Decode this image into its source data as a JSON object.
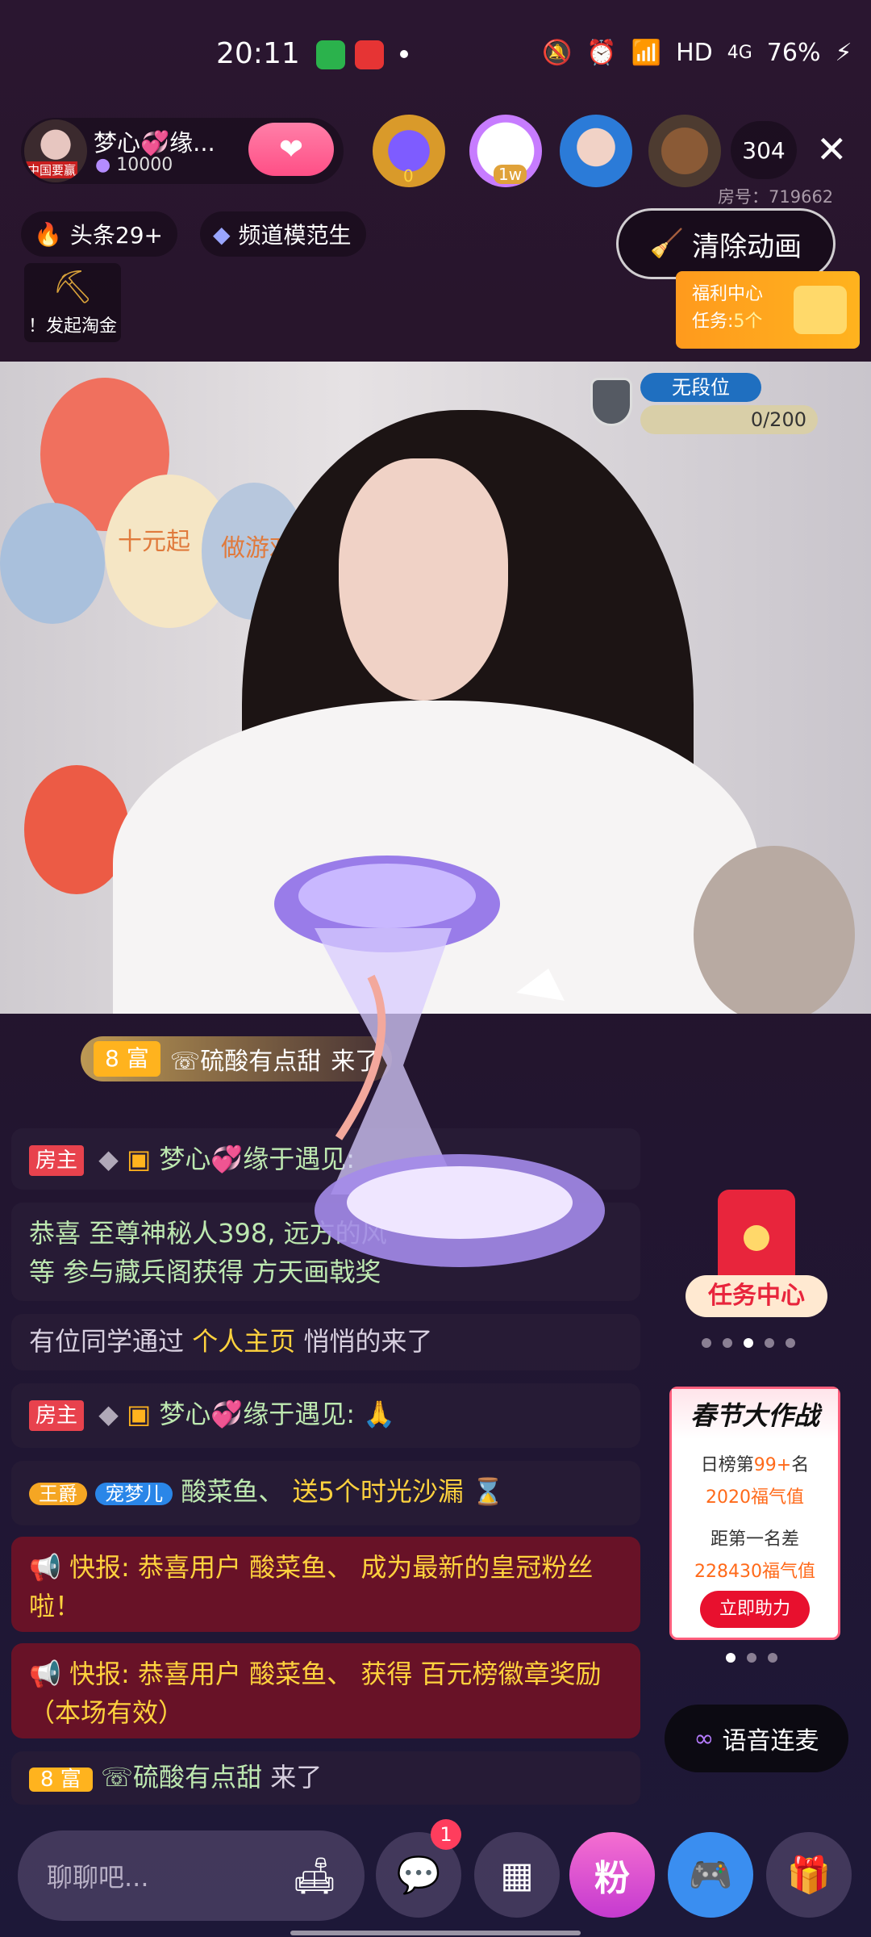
{
  "status_bar": {
    "time": "20:11",
    "network": "HD",
    "signal": "4G",
    "battery": "76%"
  },
  "anchor": {
    "name": "梦心💞缘...",
    "fans": "10000",
    "avatar_caption": "中国要赢"
  },
  "top_viewers": {
    "badge_count": "0",
    "badge_label": "1w",
    "online_count": "304"
  },
  "room": {
    "room_no": "房号：719662"
  },
  "tags": {
    "headline": "头条29+",
    "channel": "频道模范生"
  },
  "clear_animation": "清除动画",
  "treasure": "！发起淘金",
  "welfare": {
    "title": "福利中心",
    "task_prefix": "任务:",
    "task_count": "5个"
  },
  "rank": {
    "tier": "无段位",
    "progress": "0/200"
  },
  "balloon_text": {
    "left": "十元起",
    "right": "做游戏"
  },
  "chat": {
    "enter_top": {
      "level": "8 富",
      "user": "☏硫酸有点甜",
      "action": "来了"
    },
    "messages": [
      {
        "host": "房主",
        "user": "梦心💞缘于遇见:",
        "body": ""
      },
      {
        "line1": "恭喜 至尊神秘人398, 远方的风",
        "line2": "等 参与藏兵阁获得 方天画戟奖"
      },
      {
        "prefix": "有位同学通过",
        "link": "个人主页",
        "suffix": "悄悄的来了"
      },
      {
        "host": "房主",
        "user": "梦心💞缘于遇见:",
        "emoji": "🙏"
      },
      {
        "badge1": "王爵",
        "badge2": "宠梦儿",
        "user": "酸菜鱼、",
        "gift": "送5个时光沙漏"
      },
      {
        "text": "快报: 恭喜用户 酸菜鱼、 成为最新的皇冠粉丝啦！"
      },
      {
        "text": "快报: 恭喜用户 酸菜鱼、 获得 百元榜徽章奖励（本场有效）"
      }
    ],
    "enter_bottom": {
      "level": "8 富",
      "user": "☏硫酸有点甜",
      "action": "来了"
    }
  },
  "task_center": "任务中心",
  "spring_event": {
    "title": "春节大作战",
    "line1_prefix": "日榜第",
    "line1_rank": "99+",
    "line1_suffix": "名",
    "line2": "2020福气值",
    "line3": "距第一名差",
    "line4": "228430福气值",
    "button": "立即助力"
  },
  "voice_link": "语音连麦",
  "bottom": {
    "chat_placeholder": "聊聊吧...",
    "fans_label": "粉",
    "msg_badge": "1"
  }
}
